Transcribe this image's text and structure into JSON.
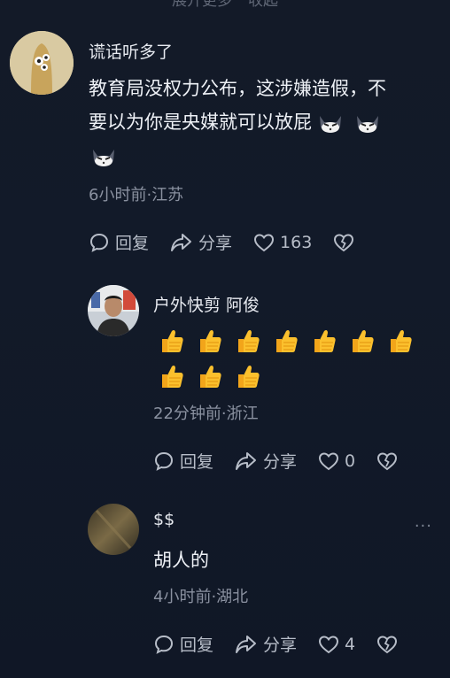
{
  "top_bar": {
    "expand_text": "展开更多",
    "collapse_text": "收起"
  },
  "comments": [
    {
      "name": "谎话听多了",
      "text_line1": "教育局没权力公布，这涉嫌造假，不",
      "text_line2": "要以为你是央媒就可以放屁",
      "emoji": "cat-emoji",
      "meta": "6小时前·江苏",
      "reply_label": "回复",
      "share_label": "分享",
      "like_count": "163"
    },
    {
      "name": "户外快剪 阿俊",
      "emoji": "thumbs-up",
      "emoji_count": 10,
      "meta": "22分钟前·浙江",
      "reply_label": "回复",
      "share_label": "分享",
      "like_count": "0"
    },
    {
      "name": "$$",
      "text": "胡人的",
      "meta": "4小时前·湖北",
      "reply_label": "回复",
      "share_label": "分享",
      "like_count": "4",
      "more": "···"
    }
  ]
}
